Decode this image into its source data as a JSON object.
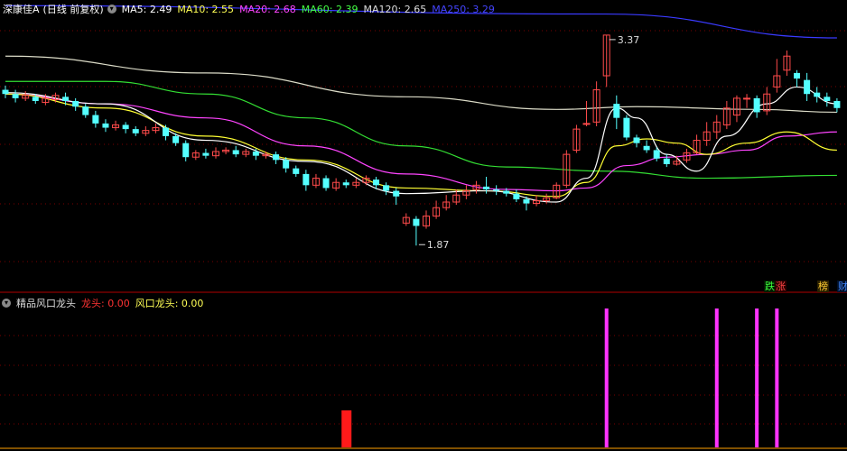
{
  "header": {
    "title": "深康佳A",
    "period": "(日线 前复权)",
    "ma": [
      {
        "label": "MA5: 2.49",
        "color": "#ffffff"
      },
      {
        "label": "MA10: 2.55",
        "color": "#ffff55"
      },
      {
        "label": "MA20: 2.68",
        "color": "#ff44ff"
      },
      {
        "label": "MA60: 2.39",
        "color": "#44ff44"
      },
      {
        "label": "MA120: 2.65",
        "color": "#dddddd"
      },
      {
        "label": "MA250: 3.29",
        "color": "#4444ff"
      }
    ]
  },
  "indicator": {
    "name": "精品风口龙头",
    "dragon_label": "龙头: 0.00",
    "wind_label": "风口龙头: 0.00"
  },
  "tags": {
    "t1": "跌",
    "t2": "涨",
    "t3": "榜",
    "t4": "财"
  },
  "chart_data": {
    "type": "candlestick",
    "price_range": [
      1.55,
      3.62
    ],
    "high_label": "3.37",
    "low_label": "1.87",
    "candles": [
      [
        2.98,
        2.95,
        3.01,
        2.92
      ],
      [
        2.95,
        2.92,
        2.98,
        2.89
      ],
      [
        2.92,
        2.94,
        2.97,
        2.9
      ],
      [
        2.93,
        2.9,
        2.95,
        2.88
      ],
      [
        2.89,
        2.92,
        2.95,
        2.87
      ],
      [
        2.91,
        2.94,
        2.96,
        2.89
      ],
      [
        2.93,
        2.9,
        2.96,
        2.87
      ],
      [
        2.9,
        2.86,
        2.92,
        2.83
      ],
      [
        2.86,
        2.8,
        2.88,
        2.78
      ],
      [
        2.8,
        2.74,
        2.83,
        2.71
      ],
      [
        2.74,
        2.71,
        2.77,
        2.68
      ],
      [
        2.71,
        2.73,
        2.76,
        2.69
      ],
      [
        2.73,
        2.7,
        2.75,
        2.67
      ],
      [
        2.7,
        2.67,
        2.72,
        2.65
      ],
      [
        2.67,
        2.69,
        2.72,
        2.65
      ],
      [
        2.69,
        2.71,
        2.74,
        2.67
      ],
      [
        2.71,
        2.65,
        2.73,
        2.62
      ],
      [
        2.65,
        2.6,
        2.67,
        2.58
      ],
      [
        2.6,
        2.5,
        2.62,
        2.47
      ],
      [
        2.5,
        2.53,
        2.55,
        2.48
      ],
      [
        2.53,
        2.51,
        2.56,
        2.49
      ],
      [
        2.51,
        2.54,
        2.57,
        2.49
      ],
      [
        2.54,
        2.55,
        2.57,
        2.52
      ],
      [
        2.55,
        2.52,
        2.58,
        2.5
      ],
      [
        2.52,
        2.54,
        2.56,
        2.5
      ],
      [
        2.54,
        2.51,
        2.56,
        2.48
      ],
      [
        2.51,
        2.52,
        2.54,
        2.49
      ],
      [
        2.52,
        2.48,
        2.54,
        2.45
      ],
      [
        2.48,
        2.42,
        2.5,
        2.39
      ],
      [
        2.42,
        2.38,
        2.44,
        2.36
      ],
      [
        2.38,
        2.3,
        2.41,
        2.26
      ],
      [
        2.3,
        2.35,
        2.38,
        2.28
      ],
      [
        2.35,
        2.28,
        2.37,
        2.26
      ],
      [
        2.28,
        2.32,
        2.35,
        2.26
      ],
      [
        2.32,
        2.3,
        2.34,
        2.28
      ],
      [
        2.3,
        2.32,
        2.35,
        2.28
      ],
      [
        2.32,
        2.35,
        2.37,
        2.3
      ],
      [
        2.34,
        2.3,
        2.36,
        2.27
      ],
      [
        2.3,
        2.26,
        2.32,
        2.23
      ],
      [
        2.26,
        2.22,
        2.28,
        2.16
      ],
      [
        2.03,
        2.07,
        2.1,
        2.01
      ],
      [
        2.06,
        2.01,
        2.08,
        1.87
      ],
      [
        2.01,
        2.08,
        2.12,
        1.99
      ],
      [
        2.08,
        2.14,
        2.19,
        2.06
      ],
      [
        2.14,
        2.18,
        2.23,
        2.12
      ],
      [
        2.18,
        2.23,
        2.27,
        2.16
      ],
      [
        2.23,
        2.26,
        2.3,
        2.2
      ],
      [
        2.27,
        2.3,
        2.33,
        2.24
      ],
      [
        2.29,
        2.27,
        2.36,
        2.24
      ],
      [
        2.27,
        2.26,
        2.3,
        2.23
      ],
      [
        2.26,
        2.24,
        2.28,
        2.22
      ],
      [
        2.24,
        2.2,
        2.27,
        2.18
      ],
      [
        2.2,
        2.17,
        2.22,
        2.12
      ],
      [
        2.17,
        2.19,
        2.23,
        2.15
      ],
      [
        2.19,
        2.21,
        2.24,
        2.17
      ],
      [
        2.21,
        2.3,
        2.32,
        2.2
      ],
      [
        2.3,
        2.52,
        2.55,
        2.28
      ],
      [
        2.55,
        2.7,
        2.73,
        2.53
      ],
      [
        2.74,
        2.74,
        2.9,
        2.72
      ],
      [
        2.75,
        2.98,
        3.04,
        2.72
      ],
      [
        3.08,
        3.37,
        3.37,
        3.0
      ],
      [
        2.88,
        2.78,
        2.94,
        2.7
      ],
      [
        2.78,
        2.64,
        2.8,
        2.62
      ],
      [
        2.64,
        2.6,
        2.66,
        2.57
      ],
      [
        2.58,
        2.55,
        2.62,
        2.53
      ],
      [
        2.55,
        2.49,
        2.57,
        2.47
      ],
      [
        2.49,
        2.45,
        2.52,
        2.43
      ],
      [
        2.45,
        2.47,
        2.51,
        2.44
      ],
      [
        2.48,
        2.53,
        2.56,
        2.46
      ],
      [
        2.53,
        2.62,
        2.66,
        2.52
      ],
      [
        2.62,
        2.68,
        2.75,
        2.58
      ],
      [
        2.68,
        2.75,
        2.8,
        2.63
      ],
      [
        2.73,
        2.85,
        2.9,
        2.7
      ],
      [
        2.8,
        2.92,
        2.94,
        2.75
      ],
      [
        2.92,
        2.92,
        2.95,
        2.85
      ],
      [
        2.92,
        2.82,
        2.94,
        2.78
      ],
      [
        2.83,
        2.95,
        3.0,
        2.8
      ],
      [
        3.0,
        3.08,
        3.2,
        2.96
      ],
      [
        3.12,
        3.22,
        3.26,
        3.08
      ],
      [
        3.1,
        3.06,
        3.12,
        3.0
      ],
      [
        3.05,
        2.95,
        3.1,
        2.9
      ],
      [
        2.96,
        2.93,
        3.0,
        2.89
      ],
      [
        2.93,
        2.9,
        2.96,
        2.86
      ],
      [
        2.9,
        2.85,
        2.92,
        2.82
      ]
    ],
    "ma_series": [
      {
        "name": "MA250",
        "color": "#3a3aff",
        "points": [
          [
            0,
            3.58
          ],
          [
            60,
            3.52
          ],
          [
            83,
            3.35
          ]
        ]
      },
      {
        "name": "MA120",
        "color": "#dcdcc8",
        "points": [
          [
            0,
            3.22
          ],
          [
            20,
            3.1
          ],
          [
            40,
            2.93
          ],
          [
            55,
            2.84
          ],
          [
            63,
            2.86
          ],
          [
            75,
            2.84
          ],
          [
            83,
            2.82
          ]
        ]
      },
      {
        "name": "MA60",
        "color": "#33dd33",
        "points": [
          [
            0,
            3.04
          ],
          [
            10,
            3.04
          ],
          [
            20,
            2.95
          ],
          [
            30,
            2.78
          ],
          [
            40,
            2.58
          ],
          [
            50,
            2.43
          ],
          [
            60,
            2.4
          ],
          [
            70,
            2.35
          ],
          [
            83,
            2.37
          ]
        ]
      },
      {
        "name": "MA20",
        "color": "#ff44ff",
        "points": [
          [
            0,
            2.95
          ],
          [
            10,
            2.88
          ],
          [
            20,
            2.78
          ],
          [
            30,
            2.58
          ],
          [
            40,
            2.38
          ],
          [
            50,
            2.27
          ],
          [
            55,
            2.26
          ],
          [
            58,
            2.28
          ],
          [
            62,
            2.44
          ],
          [
            66,
            2.5
          ],
          [
            70,
            2.52
          ],
          [
            74,
            2.55
          ],
          [
            78,
            2.65
          ],
          [
            83,
            2.68
          ]
        ]
      },
      {
        "name": "MA10",
        "color": "#ffff33",
        "points": [
          [
            0,
            2.95
          ],
          [
            10,
            2.85
          ],
          [
            20,
            2.65
          ],
          [
            30,
            2.48
          ],
          [
            40,
            2.28
          ],
          [
            48,
            2.26
          ],
          [
            55,
            2.22
          ],
          [
            58,
            2.32
          ],
          [
            61,
            2.58
          ],
          [
            64,
            2.63
          ],
          [
            67,
            2.6
          ],
          [
            70,
            2.52
          ],
          [
            74,
            2.6
          ],
          [
            78,
            2.68
          ],
          [
            83,
            2.55
          ]
        ]
      },
      {
        "name": "MA5",
        "color": "#ffffff",
        "points": [
          [
            0,
            2.96
          ],
          [
            10,
            2.88
          ],
          [
            20,
            2.62
          ],
          [
            30,
            2.47
          ],
          [
            40,
            2.24
          ],
          [
            48,
            2.26
          ],
          [
            55,
            2.18
          ],
          [
            58,
            2.35
          ],
          [
            61,
            2.85
          ],
          [
            63,
            2.78
          ],
          [
            66,
            2.52
          ],
          [
            69,
            2.4
          ],
          [
            72,
            2.65
          ],
          [
            76,
            2.88
          ],
          [
            79,
            3.0
          ],
          [
            83,
            2.88
          ]
        ]
      }
    ],
    "dragon_bars": [
      {
        "index": 34,
        "value": 0.8
      }
    ],
    "wind_bars": [
      {
        "index": 60,
        "value": 3
      },
      {
        "index": 71,
        "value": 3
      },
      {
        "index": 75,
        "value": 3
      },
      {
        "index": 77,
        "value": 3
      }
    ]
  }
}
